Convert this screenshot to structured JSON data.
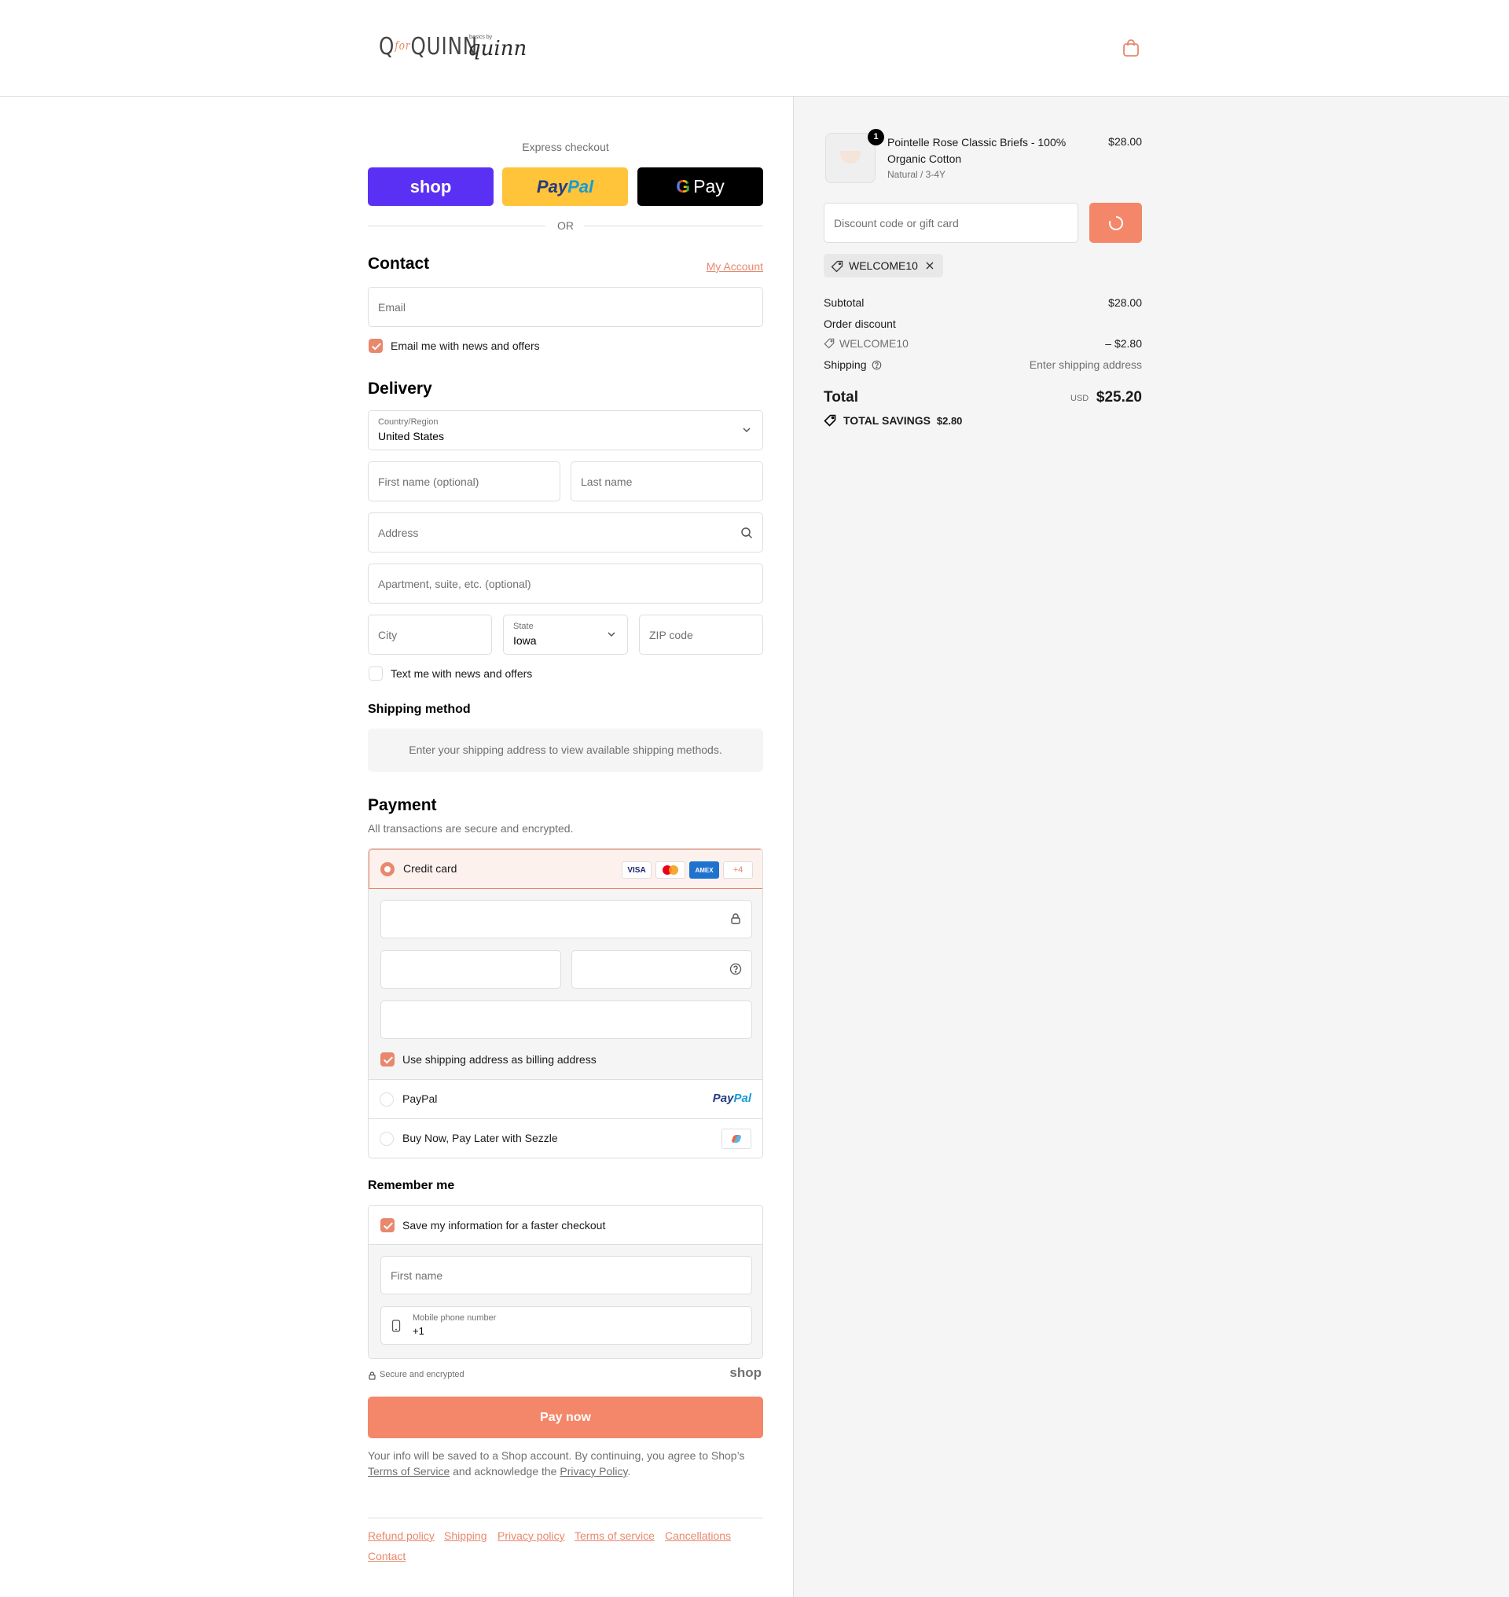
{
  "header": {
    "brand_primary": "Q",
    "brand_amp": "for",
    "brand_secondary": "QUINN",
    "sub_brand_small": "basics by",
    "sub_brand_script": "quinn"
  },
  "express": {
    "title": "Express checkout",
    "shop_label": "shop",
    "paypal_a": "Pay",
    "paypal_b": "Pal",
    "gpay_g": "G",
    "gpay_label": "Pay",
    "or_label": "OR"
  },
  "contact": {
    "title": "Contact",
    "account_link": "My Account",
    "email_placeholder": "Email",
    "newsletter_label": "Email me with news and offers"
  },
  "delivery": {
    "title": "Delivery",
    "country_label": "Country/Region",
    "country_value": "United States",
    "first_name_placeholder": "First name (optional)",
    "last_name_placeholder": "Last name",
    "address_placeholder": "Address",
    "apartment_placeholder": "Apartment, suite, etc. (optional)",
    "city_placeholder": "City",
    "state_label": "State",
    "state_value": "Iowa",
    "zip_placeholder": "ZIP code",
    "sms_label": "Text me with news and offers"
  },
  "shipping_method": {
    "title": "Shipping method",
    "message": "Enter your shipping address to view available shipping methods."
  },
  "payment": {
    "title": "Payment",
    "subtitle": "All transactions are secure and encrypted.",
    "credit_card_label": "Credit card",
    "card_badges": {
      "visa": "VISA",
      "amex": "AMEX",
      "more": "+4"
    },
    "billing_label": "Use shipping address as billing address",
    "paypal_label": "PayPal",
    "paypal_logo_a": "Pay",
    "paypal_logo_b": "Pal",
    "sezzle_label": "Buy Now, Pay Later with Sezzle"
  },
  "remember": {
    "title": "Remember me",
    "save_label": "Save my information for a faster checkout",
    "first_name_placeholder": "First name",
    "phone_label": "Mobile phone number",
    "phone_value": "+1",
    "secure_label": "Secure and encrypted",
    "shop_logo": "shop"
  },
  "pay_now_label": "Pay now",
  "legal": {
    "line1": "Your info will be saved to a Shop account. By continuing, you agree to Shop’s",
    "terms_link": "Terms of Service",
    "middle": "and acknowledge the",
    "privacy_link": "Privacy Policy",
    "end": "."
  },
  "footer_links": [
    "Refund policy",
    "Shipping",
    "Privacy policy",
    "Terms of service",
    "Cancellations",
    "Contact"
  ],
  "summary": {
    "item_qty": "1",
    "item_name_line1": "Pointelle Rose Classic Briefs - 100%",
    "item_name_line2": "Organic Cotton",
    "item_variant": "Natural / 3-4Y",
    "item_price": "$28.00",
    "discount_placeholder": "Discount code or gift card",
    "applied_code": "WELCOME10",
    "subtotal_label": "Subtotal",
    "subtotal_value": "$28.00",
    "order_discount_label": "Order discount",
    "discount_code": "WELCOME10",
    "discount_value": "– $2.80",
    "shipping_label": "Shipping",
    "shipping_value": "Enter shipping address",
    "total_label": "Total",
    "currency": "USD",
    "total_value": "$25.20",
    "savings_label": "TOTAL SAVINGS",
    "savings_value": "$2.80"
  },
  "colors": {
    "accent": "#e8886c",
    "button": "#f4876a",
    "shop_purple": "#5a31f4",
    "paypal_yellow": "#ffc439"
  }
}
